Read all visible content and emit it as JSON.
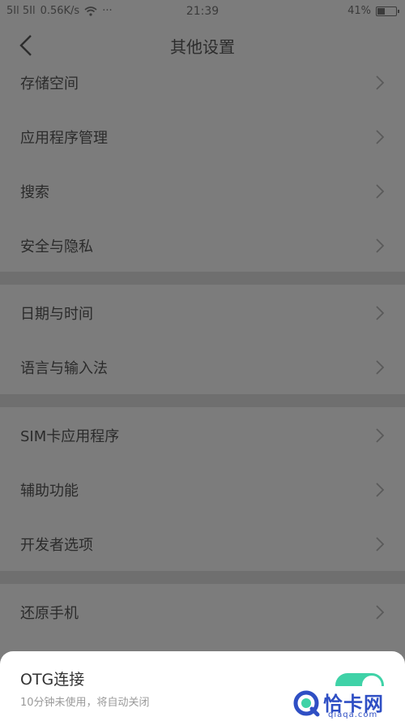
{
  "status_bar": {
    "signal_text": "5Il 5Il",
    "network_speed": "0.56K/s",
    "more": "···",
    "time": "21:39",
    "battery_percent": "41%",
    "battery_level": 0.41
  },
  "header": {
    "title": "其他设置"
  },
  "groups": [
    [
      "存储空间",
      "应用程序管理",
      "搜索",
      "安全与隐私"
    ],
    [
      "日期与时间",
      "语言与输入法"
    ],
    [
      "SIM卡应用程序",
      "辅助功能",
      "开发者选项"
    ],
    [
      "还原手机"
    ]
  ],
  "otg": {
    "title": "OTG连接",
    "subtitle": "10分钟未使用，将自动关闭",
    "enabled": true
  },
  "watermark": {
    "brand": "恰卡网",
    "domain": "qiaqa.com"
  },
  "colors": {
    "accent": "#3fd2a7",
    "watermark_blue": "#2f4fc4"
  }
}
